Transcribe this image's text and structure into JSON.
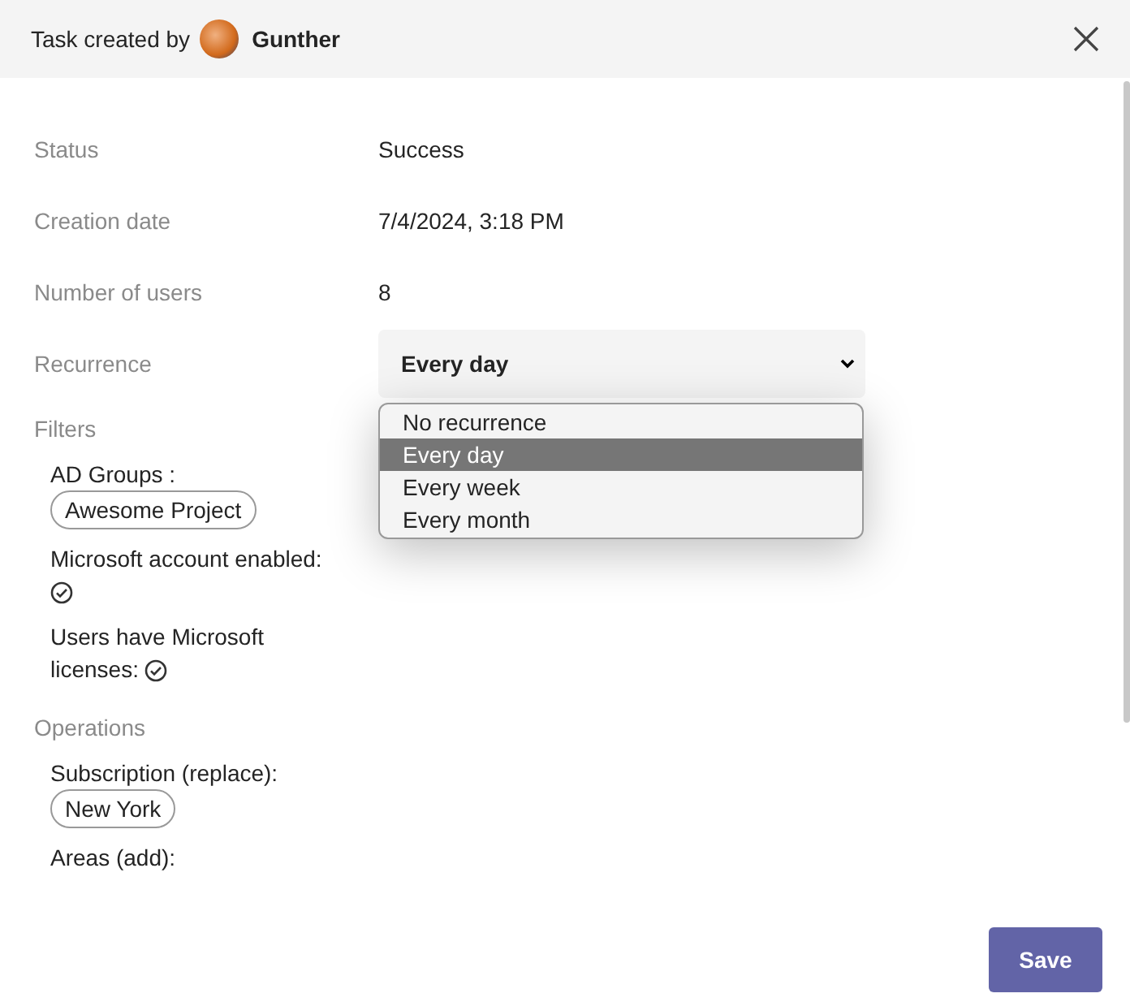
{
  "header": {
    "prefix": "Task created by",
    "user": "Gunther"
  },
  "details": [
    {
      "label": "Status",
      "value": "Success"
    },
    {
      "label": "Creation date",
      "value": "7/4/2024, 3:18 PM"
    },
    {
      "label": "Number of users",
      "value": "8"
    }
  ],
  "recurrence": {
    "label": "Recurrence",
    "value": "Every day",
    "expanded": true,
    "options": [
      {
        "label": "No recurrence",
        "selected": false
      },
      {
        "label": "Every day",
        "selected": true
      },
      {
        "label": "Every week",
        "selected": false
      },
      {
        "label": "Every month",
        "selected": false
      }
    ]
  },
  "sections": [
    {
      "title": "Filters",
      "items": [
        {
          "kind": "tags",
          "label": "AD Groups :",
          "tags": [
            "Awesome Project"
          ]
        },
        {
          "kind": "flag",
          "label": "Microsoft account enabled:",
          "checked": true
        },
        {
          "kind": "flag",
          "label": "Users have Microsoft licenses:",
          "checked": true
        }
      ]
    },
    {
      "title": "Operations",
      "items": [
        {
          "kind": "tags",
          "label": "Subscription (replace):",
          "tags": [
            "New York"
          ]
        },
        {
          "kind": "tags",
          "label": "Areas (add):"
        }
      ]
    }
  ],
  "save_button": "Save"
}
